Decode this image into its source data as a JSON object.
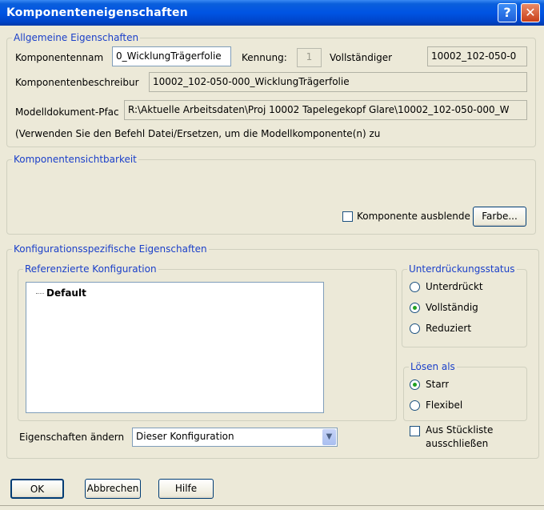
{
  "window": {
    "title": "Komponenteneigenschaften",
    "help_glyph": "?",
    "close_glyph": "✕"
  },
  "general": {
    "legend": "Allgemeine Eigenschaften",
    "name_label": "Komponentennam",
    "name_value": "0_WicklungTrägerfolie",
    "id_label": "Kennung:",
    "id_value": "1",
    "full_label": "Vollständiger",
    "full_value": "10002_102-050-0",
    "desc_label": "Komponentenbeschreibur",
    "desc_value": "10002_102-050-000_WicklungTrägerfolie",
    "path_label": "Modelldokument-Pfac",
    "path_value": "R:\\Aktuelle Arbeitsdaten\\Proj 10002 Tapelegekopf Glare\\10002_102-050-000_W",
    "hint": "(Verwenden Sie den Befehl Datei/Ersetzen, um die Modellkomponente(n) zu"
  },
  "visibility": {
    "legend": "Komponentensichtbarkeit",
    "hide_label": "Komponente ausblende",
    "color_button": "Farbe..."
  },
  "config": {
    "legend": "Konfigurationsspezifische Eigenschaften",
    "ref_legend": "Referenzierte Konfiguration",
    "tree_item": "Default",
    "suppress_legend": "Unterdrückungsstatus",
    "suppress_options": [
      "Unterdrückt",
      "Vollständig",
      "Reduziert"
    ],
    "suppress_selected": "Vollständig",
    "solve_legend": "Lösen als",
    "solve_options": [
      "Starr",
      "Flexibel"
    ],
    "solve_selected": "Starr",
    "exclude_label_1": "Aus Stückliste",
    "exclude_label_2": "ausschließen",
    "change_label": "Eigenschaften ändern",
    "change_value": "Dieser Konfiguration",
    "dropdown_glyph": "▼"
  },
  "buttons": {
    "ok": "OK",
    "cancel": "Abbrechen",
    "help": "Hilfe"
  }
}
